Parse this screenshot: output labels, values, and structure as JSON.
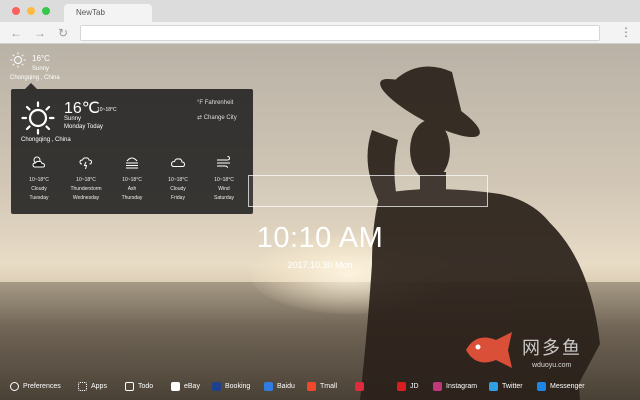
{
  "browser": {
    "tab_title": "NewTab",
    "nav": {
      "back": "←",
      "forward": "→",
      "reload": "↻",
      "menu": "⋮"
    },
    "address_value": ""
  },
  "weather_mini": {
    "temp": "16°C",
    "condition": "Sunny",
    "city": "Chongqing , China"
  },
  "weather_panel": {
    "temp": "16℃",
    "range": "10~18°C",
    "condition": "Sunny",
    "day": "Monday Today",
    "city": "Chongqing , China",
    "opt_fahrenheit": "°F  Fahrenheit",
    "opt_change_city": "⇄  Change City",
    "forecast": [
      {
        "icon": "cloudy-sun-icon",
        "range": "10~18°C",
        "cond": "Cloudy",
        "day": "Tuesday"
      },
      {
        "icon": "thunderstorm-icon",
        "range": "10~18°C",
        "cond": "Thunderstorm",
        "day": "Wednesday"
      },
      {
        "icon": "ash-icon",
        "range": "10~18°C",
        "cond": "Ash",
        "day": "Thursday"
      },
      {
        "icon": "cloud-icon",
        "range": "10~18°C",
        "cond": "Cloudy",
        "day": "Friday"
      },
      {
        "icon": "wind-icon",
        "range": "10~18°C",
        "cond": "Wind",
        "day": "Saturday"
      }
    ]
  },
  "clock": {
    "time": "10:10 AM",
    "date": "2017.10.30 Mon"
  },
  "watermark": {
    "brand": "网多鱼",
    "url": "wduoyu.com"
  },
  "bottom_bar": [
    {
      "label": "Preferences",
      "icon": "gear-icon",
      "color": "#ffffff"
    },
    {
      "label": "Apps",
      "icon": "grid-icon",
      "color": "#ffffff"
    },
    {
      "label": "Todo",
      "icon": "checkbox-icon",
      "color": "#ffffff"
    },
    {
      "label": "eBay",
      "icon": "ebay-icon",
      "color": "#ffffff"
    },
    {
      "label": "Booking",
      "icon": "booking-icon",
      "color": "#1f3f8f"
    },
    {
      "label": "Baidu",
      "icon": "baidu-icon",
      "color": "#2f7de1"
    },
    {
      "label": "Tmall",
      "icon": "tmall-icon",
      "color": "#f0482b"
    },
    {
      "label": "",
      "icon": "app-red-icon",
      "color": "#e02b3c"
    },
    {
      "label": "JD",
      "icon": "jd-icon",
      "color": "#d81e1e"
    },
    {
      "label": "Instagram",
      "icon": "instagram-icon",
      "color": "#c1377a"
    },
    {
      "label": "Twitter",
      "icon": "twitter-icon",
      "color": "#2ea0e6"
    },
    {
      "label": "Messenger",
      "icon": "messenger-icon",
      "color": "#1b86e8"
    }
  ],
  "colors": {
    "panel_bg": "#1c1c1c",
    "text": "#ffffff"
  }
}
